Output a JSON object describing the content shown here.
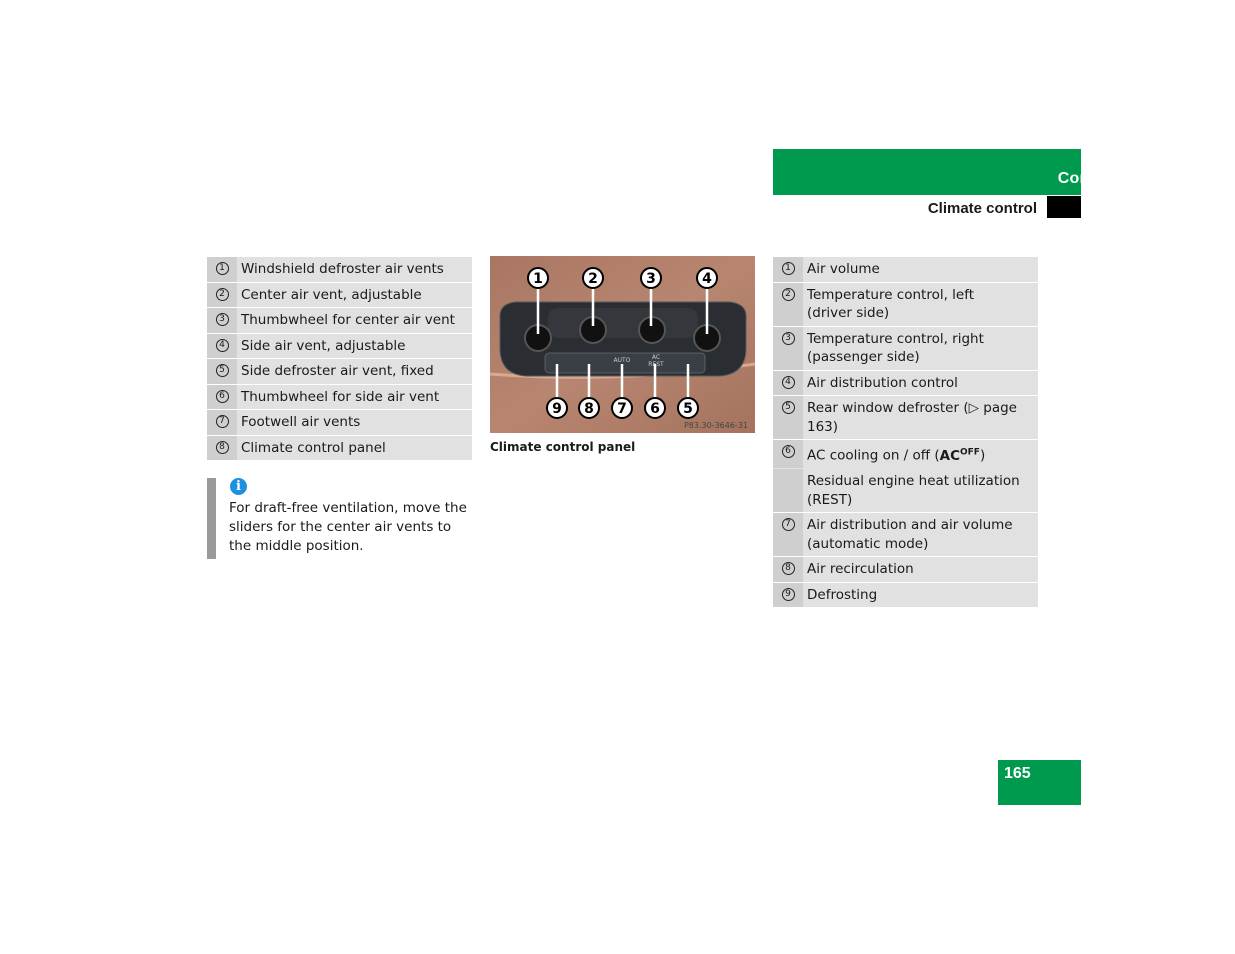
{
  "header": {
    "section": "Controls in detail",
    "subsection": "Climate control"
  },
  "left_list": [
    {
      "num": "1",
      "text": "Windshield defroster air vents"
    },
    {
      "num": "2",
      "text": "Center air vent, adjustable"
    },
    {
      "num": "3",
      "text": "Thumbwheel for center air vent"
    },
    {
      "num": "4",
      "text": "Side air vent, adjustable"
    },
    {
      "num": "5",
      "text": "Side defroster air vent, fixed"
    },
    {
      "num": "6",
      "text": "Thumbwheel for side air vent"
    },
    {
      "num": "7",
      "text": "Footwell air vents"
    },
    {
      "num": "8",
      "text": "Climate control panel"
    }
  ],
  "note": {
    "icon": "info-icon",
    "text": "For draft-free ventilation, move the sliders for the center air vents to the middle position."
  },
  "figure": {
    "caption": "Climate control panel",
    "code": "P83.30-3646-31",
    "button_auto": "AUTO",
    "button_ac": "AC",
    "button_rest": "REST",
    "callouts_top": [
      "1",
      "2",
      "3",
      "4"
    ],
    "callouts_bottom": [
      "9",
      "8",
      "7",
      "6",
      "5"
    ]
  },
  "right_list": [
    {
      "num": "1",
      "lines": [
        "Air volume"
      ]
    },
    {
      "num": "2",
      "lines": [
        "Temperature control, left",
        "(driver side)"
      ]
    },
    {
      "num": "3",
      "lines": [
        "Temperature control, right",
        "(passenger side)"
      ]
    },
    {
      "num": "4",
      "lines": [
        "Air distribution control"
      ]
    },
    {
      "num": "5",
      "lines": [
        "Rear window defroster (▷ page 163)"
      ]
    },
    {
      "num": "6",
      "lines": [
        "AC cooling on  / off ("
      ],
      "bold": "AC",
      "sup": "OFF",
      "after": ")"
    },
    {
      "num": "",
      "lines": [
        "Residual engine heat utilization",
        "(REST)"
      ]
    },
    {
      "num": "7",
      "lines": [
        "Air distribution and air volume",
        "(automatic mode)"
      ]
    },
    {
      "num": "8",
      "lines": [
        "Air recirculation"
      ]
    },
    {
      "num": "9",
      "lines": [
        "Defrosting"
      ]
    }
  ],
  "page_number": "165",
  "colors": {
    "brand_green": "#009a4e",
    "row_bg": "#e1e1e1",
    "num_bg": "#cfcfcf"
  }
}
